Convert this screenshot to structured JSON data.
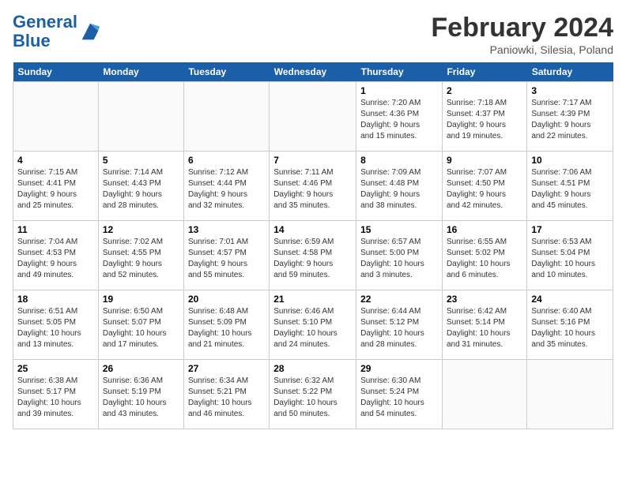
{
  "header": {
    "logo_line1": "General",
    "logo_line2": "Blue",
    "title": "February 2024",
    "subtitle": "Paniowki, Silesia, Poland"
  },
  "days_of_week": [
    "Sunday",
    "Monday",
    "Tuesday",
    "Wednesday",
    "Thursday",
    "Friday",
    "Saturday"
  ],
  "weeks": [
    [
      {
        "day": "",
        "info": ""
      },
      {
        "day": "",
        "info": ""
      },
      {
        "day": "",
        "info": ""
      },
      {
        "day": "",
        "info": ""
      },
      {
        "day": "1",
        "info": "Sunrise: 7:20 AM\nSunset: 4:36 PM\nDaylight: 9 hours\nand 15 minutes."
      },
      {
        "day": "2",
        "info": "Sunrise: 7:18 AM\nSunset: 4:37 PM\nDaylight: 9 hours\nand 19 minutes."
      },
      {
        "day": "3",
        "info": "Sunrise: 7:17 AM\nSunset: 4:39 PM\nDaylight: 9 hours\nand 22 minutes."
      }
    ],
    [
      {
        "day": "4",
        "info": "Sunrise: 7:15 AM\nSunset: 4:41 PM\nDaylight: 9 hours\nand 25 minutes."
      },
      {
        "day": "5",
        "info": "Sunrise: 7:14 AM\nSunset: 4:43 PM\nDaylight: 9 hours\nand 28 minutes."
      },
      {
        "day": "6",
        "info": "Sunrise: 7:12 AM\nSunset: 4:44 PM\nDaylight: 9 hours\nand 32 minutes."
      },
      {
        "day": "7",
        "info": "Sunrise: 7:11 AM\nSunset: 4:46 PM\nDaylight: 9 hours\nand 35 minutes."
      },
      {
        "day": "8",
        "info": "Sunrise: 7:09 AM\nSunset: 4:48 PM\nDaylight: 9 hours\nand 38 minutes."
      },
      {
        "day": "9",
        "info": "Sunrise: 7:07 AM\nSunset: 4:50 PM\nDaylight: 9 hours\nand 42 minutes."
      },
      {
        "day": "10",
        "info": "Sunrise: 7:06 AM\nSunset: 4:51 PM\nDaylight: 9 hours\nand 45 minutes."
      }
    ],
    [
      {
        "day": "11",
        "info": "Sunrise: 7:04 AM\nSunset: 4:53 PM\nDaylight: 9 hours\nand 49 minutes."
      },
      {
        "day": "12",
        "info": "Sunrise: 7:02 AM\nSunset: 4:55 PM\nDaylight: 9 hours\nand 52 minutes."
      },
      {
        "day": "13",
        "info": "Sunrise: 7:01 AM\nSunset: 4:57 PM\nDaylight: 9 hours\nand 55 minutes."
      },
      {
        "day": "14",
        "info": "Sunrise: 6:59 AM\nSunset: 4:58 PM\nDaylight: 9 hours\nand 59 minutes."
      },
      {
        "day": "15",
        "info": "Sunrise: 6:57 AM\nSunset: 5:00 PM\nDaylight: 10 hours\nand 3 minutes."
      },
      {
        "day": "16",
        "info": "Sunrise: 6:55 AM\nSunset: 5:02 PM\nDaylight: 10 hours\nand 6 minutes."
      },
      {
        "day": "17",
        "info": "Sunrise: 6:53 AM\nSunset: 5:04 PM\nDaylight: 10 hours\nand 10 minutes."
      }
    ],
    [
      {
        "day": "18",
        "info": "Sunrise: 6:51 AM\nSunset: 5:05 PM\nDaylight: 10 hours\nand 13 minutes."
      },
      {
        "day": "19",
        "info": "Sunrise: 6:50 AM\nSunset: 5:07 PM\nDaylight: 10 hours\nand 17 minutes."
      },
      {
        "day": "20",
        "info": "Sunrise: 6:48 AM\nSunset: 5:09 PM\nDaylight: 10 hours\nand 21 minutes."
      },
      {
        "day": "21",
        "info": "Sunrise: 6:46 AM\nSunset: 5:10 PM\nDaylight: 10 hours\nand 24 minutes."
      },
      {
        "day": "22",
        "info": "Sunrise: 6:44 AM\nSunset: 5:12 PM\nDaylight: 10 hours\nand 28 minutes."
      },
      {
        "day": "23",
        "info": "Sunrise: 6:42 AM\nSunset: 5:14 PM\nDaylight: 10 hours\nand 31 minutes."
      },
      {
        "day": "24",
        "info": "Sunrise: 6:40 AM\nSunset: 5:16 PM\nDaylight: 10 hours\nand 35 minutes."
      }
    ],
    [
      {
        "day": "25",
        "info": "Sunrise: 6:38 AM\nSunset: 5:17 PM\nDaylight: 10 hours\nand 39 minutes."
      },
      {
        "day": "26",
        "info": "Sunrise: 6:36 AM\nSunset: 5:19 PM\nDaylight: 10 hours\nand 43 minutes."
      },
      {
        "day": "27",
        "info": "Sunrise: 6:34 AM\nSunset: 5:21 PM\nDaylight: 10 hours\nand 46 minutes."
      },
      {
        "day": "28",
        "info": "Sunrise: 6:32 AM\nSunset: 5:22 PM\nDaylight: 10 hours\nand 50 minutes."
      },
      {
        "day": "29",
        "info": "Sunrise: 6:30 AM\nSunset: 5:24 PM\nDaylight: 10 hours\nand 54 minutes."
      },
      {
        "day": "",
        "info": ""
      },
      {
        "day": "",
        "info": ""
      }
    ]
  ]
}
